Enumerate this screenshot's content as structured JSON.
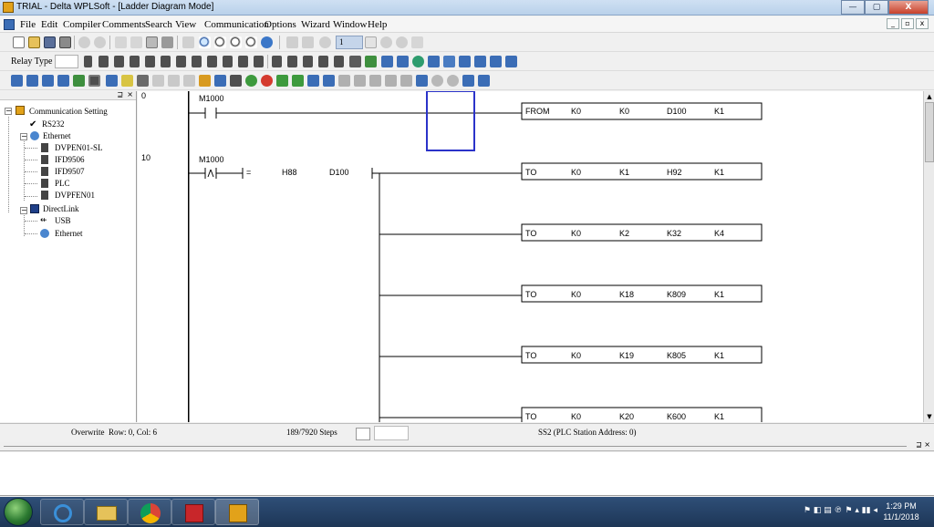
{
  "window": {
    "title": "TRIAL - Delta WPLSoft - [Ladder Diagram Mode]",
    "minimize": "—",
    "maximize": "▢",
    "close": "X"
  },
  "menu": [
    "File",
    "Edit",
    "Compiler",
    "Comments",
    "Search",
    "View",
    "Communication",
    "Options",
    "Wizard",
    "Window",
    "Help"
  ],
  "mdi_controls": [
    "_",
    "▫",
    "x"
  ],
  "toolbar": {
    "step_value": "1",
    "relay_type_label": "Relay Type"
  },
  "panel": {
    "pin": "⊒",
    "close": "×"
  },
  "tree": {
    "root": "Communication Setting",
    "rs232": "RS232",
    "ethernet": "Ethernet",
    "ethernet_children": [
      "DVPEN01-SL",
      "IFD9506",
      "IFD9507",
      "PLC",
      "DVPFEN01"
    ],
    "directlink": "DirectLink",
    "directlink_children": [
      "USB",
      "Ethernet"
    ]
  },
  "ladder": {
    "rung1": {
      "step": "0",
      "contact": "M1000",
      "instr": [
        "FROM",
        "K0",
        "K0",
        "D100",
        "K1"
      ]
    },
    "rung2": {
      "step": "10",
      "contact": "M1000",
      "compare": [
        "=",
        "H88",
        "D100"
      ],
      "outputs": [
        [
          "TO",
          "K0",
          "K1",
          "H92",
          "K1"
        ],
        [
          "TO",
          "K0",
          "K2",
          "K32",
          "K4"
        ],
        [
          "TO",
          "K0",
          "K18",
          "K809",
          "K1"
        ],
        [
          "TO",
          "K0",
          "K19",
          "K805",
          "K1"
        ],
        [
          "TO",
          "K0",
          "K20",
          "K600",
          "K1"
        ]
      ]
    }
  },
  "scroll": {
    "up": "▲",
    "down": "▼"
  },
  "status": {
    "mode": "Overwrite",
    "position": "Row: 0, Col: 6",
    "steps": "189/7920 Steps",
    "station": "SS2 (PLC Station Address: 0)"
  },
  "output_pin": "⊒ ×",
  "taskbar": {
    "tray": "⚑ ◧ ▤ ℗ ⚑ ▴ ▮▮ ◂",
    "time": "1:29 PM",
    "date": "11/1/2018"
  },
  "colors": {
    "cursor": "#2b33c9",
    "titlebar": "#c9dcf1",
    "taskbar": "#1f3b5e"
  }
}
